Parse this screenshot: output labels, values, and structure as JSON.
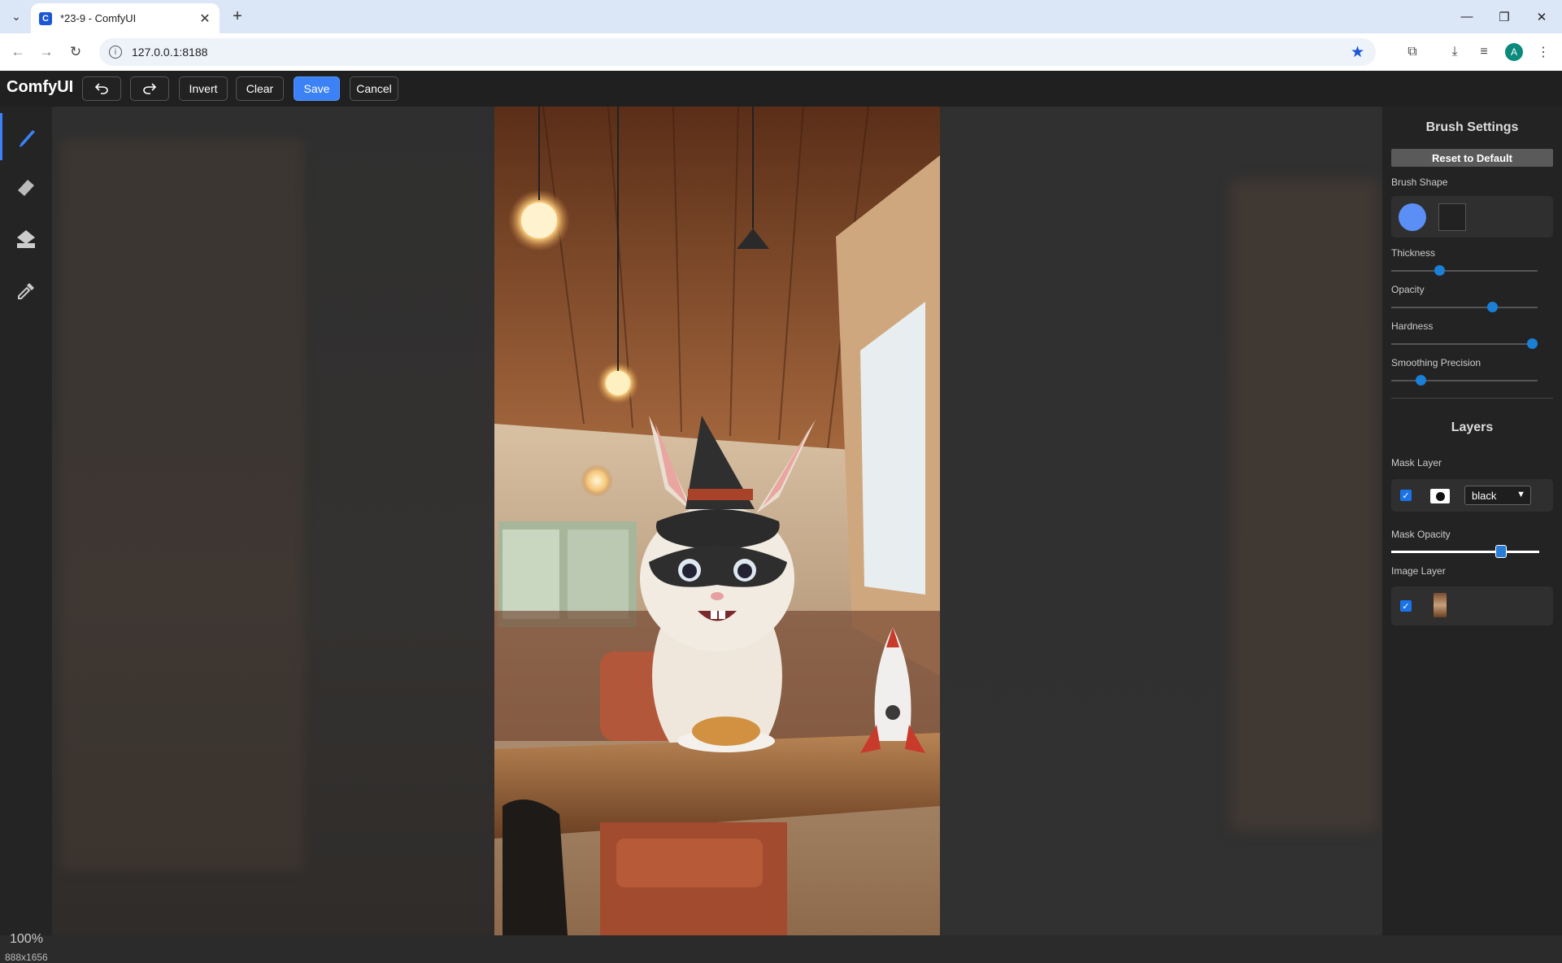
{
  "browser": {
    "tab_title": "*23-9 - ComfyUI",
    "url": "127.0.0.1:8188",
    "profile_initial": "A"
  },
  "toolbar": {
    "brand": "ComfyUI",
    "invert_label": "Invert",
    "clear_label": "Clear",
    "save_label": "Save",
    "cancel_label": "Cancel"
  },
  "tools": [
    "brush",
    "eraser",
    "paint-bucket",
    "color-picker"
  ],
  "canvas": {
    "zoom": "100%",
    "dimensions": "888x1656"
  },
  "brush_settings": {
    "title": "Brush Settings",
    "reset_label": "Reset to Default",
    "shape_label": "Brush Shape",
    "selected_shape": "circle",
    "thickness_label": "Thickness",
    "thickness_level": 0.33,
    "opacity_label": "Opacity",
    "opacity_level": 0.69,
    "hardness_label": "Hardness",
    "hardness_level": 0.96,
    "smoothing_label": "Smoothing Precision",
    "smoothing_level": 0.2
  },
  "layers": {
    "title": "Layers",
    "mask_layer_label": "Mask Layer",
    "mask_visible": true,
    "mask_color": "black",
    "mask_opacity_label": "Mask Opacity",
    "mask_opacity_level": 0.74,
    "image_layer_label": "Image Layer",
    "image_visible": true
  },
  "colors": {
    "accent": "#3b82f6",
    "panel": "#232323",
    "toolbar": "#202020"
  }
}
